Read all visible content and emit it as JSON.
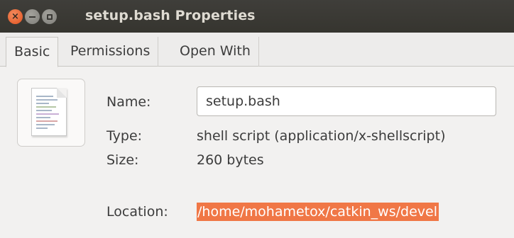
{
  "window": {
    "title": "setup.bash Properties",
    "close_glyph": "×",
    "min_icon": "minimize-icon",
    "max_icon": "maximize-icon"
  },
  "tabs": [
    {
      "label": "Basic",
      "active": true
    },
    {
      "label": "Permissions",
      "active": false
    },
    {
      "label": "Open With",
      "active": false
    }
  ],
  "file_icon": "text-document-icon",
  "fields": {
    "name_label": "Name:",
    "name_value": "setup.bash",
    "type_label": "Type:",
    "type_value": "shell script (application/x-shellscript)",
    "size_label": "Size:",
    "size_value": "260 bytes",
    "location_label": "Location:",
    "location_value": "/home/mohametox/catkin_ws/devel"
  },
  "colors": {
    "selection": "#f07746",
    "titlebar": "#3c3b37",
    "close_button": "#e95420"
  }
}
